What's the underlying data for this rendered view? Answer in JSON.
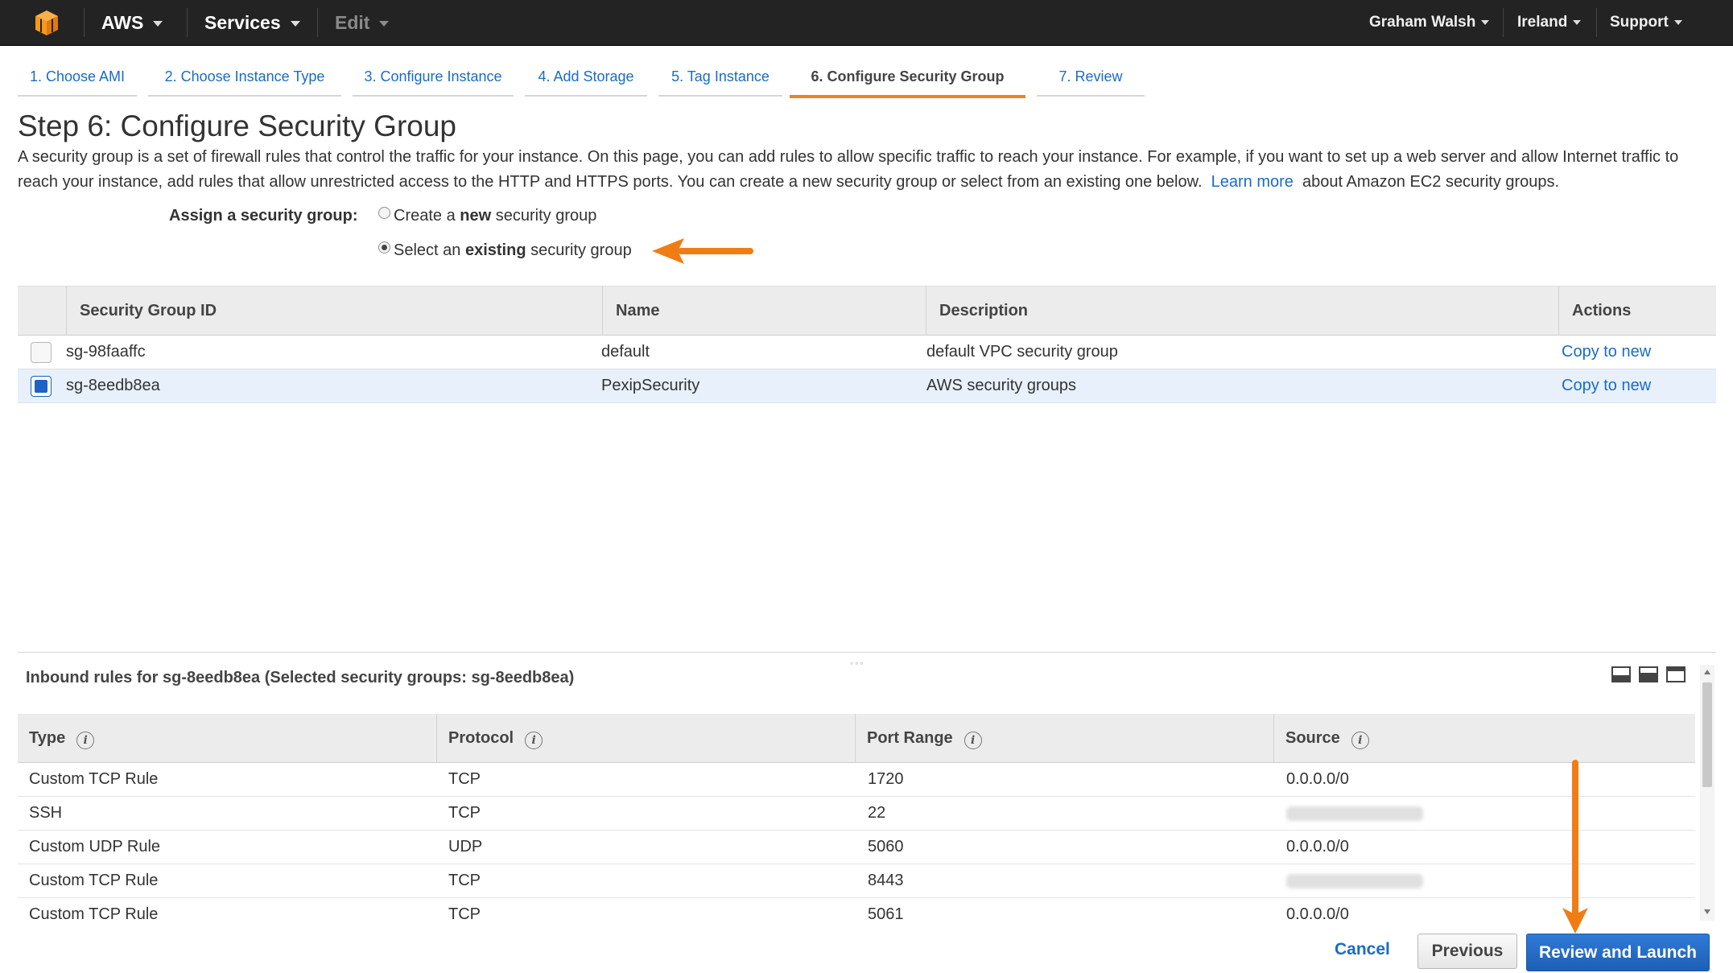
{
  "topnav": {
    "brand": "AWS",
    "services": "Services",
    "edit": "Edit",
    "user": "Graham Walsh",
    "region": "Ireland",
    "support": "Support",
    "logo_icon": "aws-cube-icon",
    "logo_color": "#f7981d"
  },
  "tabs": [
    {
      "label": "1. Choose AMI"
    },
    {
      "label": "2. Choose Instance Type"
    },
    {
      "label": "3. Configure Instance"
    },
    {
      "label": "4. Add Storage"
    },
    {
      "label": "5. Tag Instance"
    },
    {
      "label": "6. Configure Security Group"
    },
    {
      "label": "7. Review"
    }
  ],
  "page": {
    "title": "Step 6: Configure Security Group",
    "intro_text": "A security group is a set of firewall rules that control the traffic for your instance. On this page, you can add rules to allow specific traffic to reach your instance. For example, if you want to set up a web server and allow Internet traffic to reach your instance, add rules that allow unrestricted access to the HTTP and HTTPS ports. You can create a new security group or select from an existing one below.",
    "learn_more": "Learn more",
    "intro_tail": "about Amazon EC2 security groups."
  },
  "assign": {
    "label": "Assign a security group:",
    "option_new_pre": "Create a ",
    "option_new_bold": "new",
    "option_new_post": " security group",
    "option_existing_pre": "Select an ",
    "option_existing_bold": "existing",
    "option_existing_post": " security group",
    "selected": "existing"
  },
  "security_groups": {
    "headers": {
      "id": "Security Group ID",
      "name": "Name",
      "description": "Description",
      "actions": "Actions"
    },
    "rows": [
      {
        "id": "sg-98faaffc",
        "name": "default",
        "description": "default VPC security group",
        "action": "Copy to new",
        "checked": false
      },
      {
        "id": "sg-8eedb8ea",
        "name": "PexipSecurity",
        "description": "AWS security groups",
        "action": "Copy to new",
        "checked": true
      }
    ]
  },
  "inbound": {
    "title": "Inbound rules for sg-8eedb8ea (Selected security groups: sg-8eedb8ea)",
    "headers": {
      "type": "Type",
      "protocol": "Protocol",
      "port_range": "Port Range",
      "source": "Source"
    },
    "rows": [
      {
        "type": "Custom TCP Rule",
        "protocol": "TCP",
        "port": "1720",
        "source": "0.0.0.0/0",
        "redacted": false
      },
      {
        "type": "SSH",
        "protocol": "TCP",
        "port": "22",
        "source": "",
        "redacted": true
      },
      {
        "type": "Custom UDP Rule",
        "protocol": "UDP",
        "port": "5060",
        "source": "0.0.0.0/0",
        "redacted": false
      },
      {
        "type": "Custom TCP Rule",
        "protocol": "TCP",
        "port": "8443",
        "source": "",
        "redacted": true
      },
      {
        "type": "Custom TCP Rule",
        "protocol": "TCP",
        "port": "5061",
        "source": "0.0.0.0/0",
        "redacted": false
      }
    ]
  },
  "footer": {
    "cancel": "Cancel",
    "previous": "Previous",
    "review_launch": "Review and Launch"
  },
  "colors": {
    "accent": "#e8841f",
    "link": "#1a6cc4",
    "primary_button": "#1d5fb5",
    "topnav_bg": "#232323"
  }
}
